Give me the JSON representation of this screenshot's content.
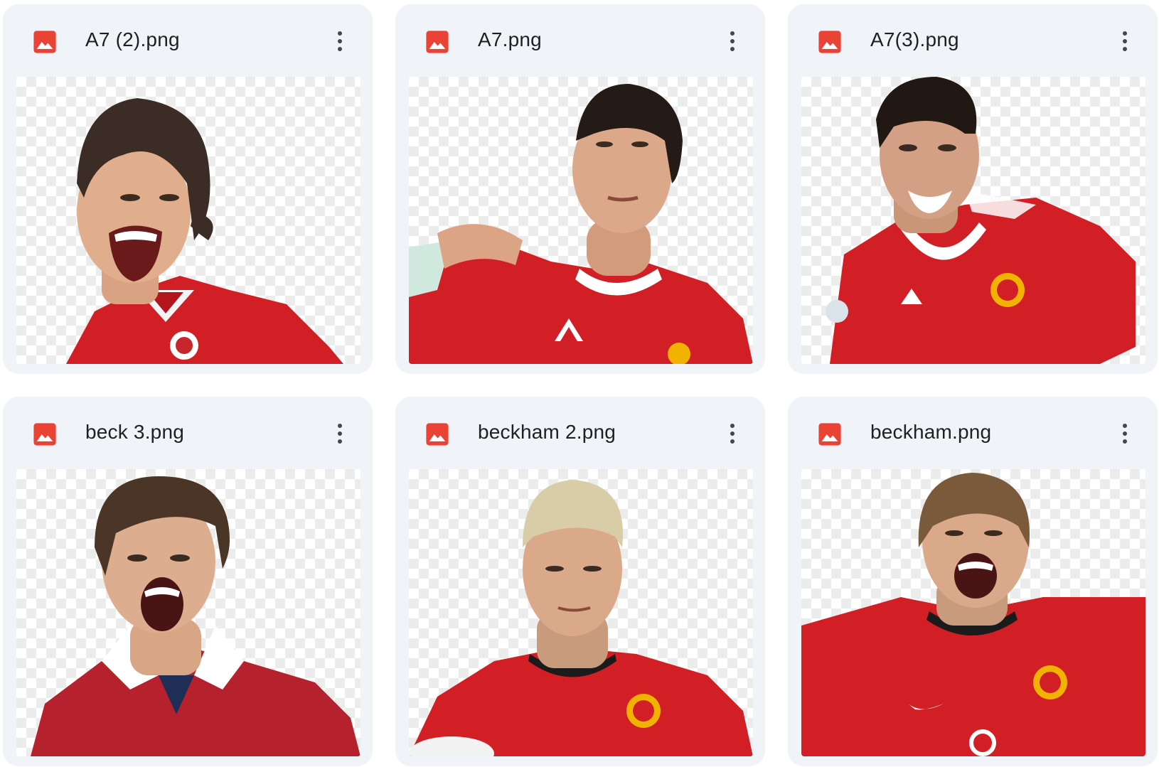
{
  "files": [
    {
      "name": "A7 (2).png",
      "type_icon": "image-icon",
      "menu_icon": "more-vert-icon",
      "thumbnail": "player-red-jersey-shouting"
    },
    {
      "name": "A7.png",
      "type_icon": "image-icon",
      "menu_icon": "more-vert-icon",
      "thumbnail": "player-red-jersey-looking-up"
    },
    {
      "name": "A7(3).png",
      "type_icon": "image-icon",
      "menu_icon": "more-vert-icon",
      "thumbnail": "player-red-jersey-celebrating"
    },
    {
      "name": "beck 3.png",
      "type_icon": "image-icon",
      "menu_icon": "more-vert-icon",
      "thumbnail": "player-red-collared-jersey-shouting"
    },
    {
      "name": "beckham 2.png",
      "type_icon": "image-icon",
      "menu_icon": "more-vert-icon",
      "thumbnail": "player-red-jersey-blond"
    },
    {
      "name": "beckham.png",
      "type_icon": "image-icon",
      "menu_icon": "more-vert-icon",
      "thumbnail": "player-red-jersey-arms-out"
    }
  ],
  "colors": {
    "card_background": "#f0f4f9",
    "image_icon": "#ea4335",
    "jersey_red": "#d21f26",
    "text": "#1f1f1f"
  }
}
